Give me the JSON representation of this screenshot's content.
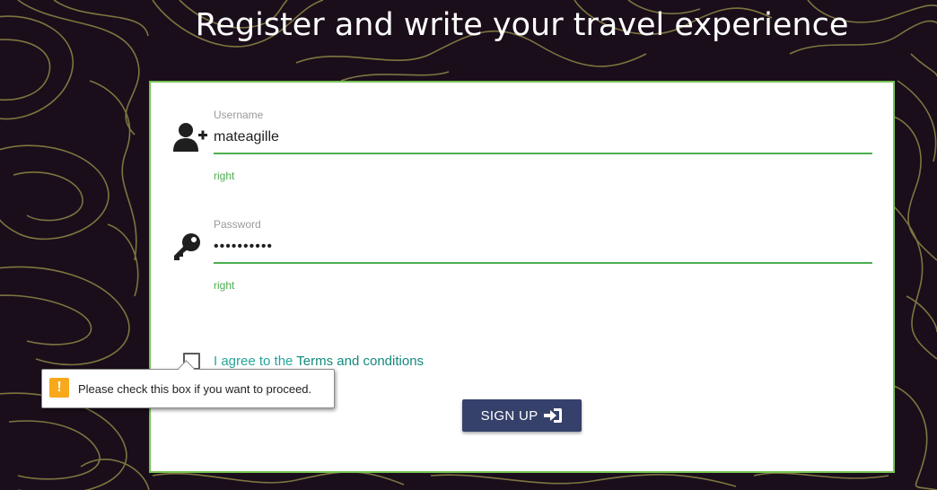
{
  "page": {
    "title": "Register and write your travel experience"
  },
  "form": {
    "username": {
      "label": "Username",
      "value": "mateagille",
      "helper": "right",
      "icon": "user-plus-icon"
    },
    "password": {
      "label": "Password",
      "value": "••••••••••",
      "helper": "right",
      "icon": "key-icon"
    },
    "agree": {
      "prefix": "I agree to the ",
      "link": "Terms and conditions",
      "checked": false
    },
    "submit": {
      "label": "SIGN UP",
      "icon": "sign-in-icon"
    }
  },
  "validation_tooltip": {
    "message": "Please check this box if you want to proceed.",
    "icon": "warning-icon"
  },
  "colors": {
    "background": "#1a0e1b",
    "contour_lines": "#8f8746",
    "card_border": "#77c253",
    "valid_green": "#4caf50",
    "teal_link": "#26a69a",
    "button": "#36416b",
    "warning": "#f7a81b"
  }
}
